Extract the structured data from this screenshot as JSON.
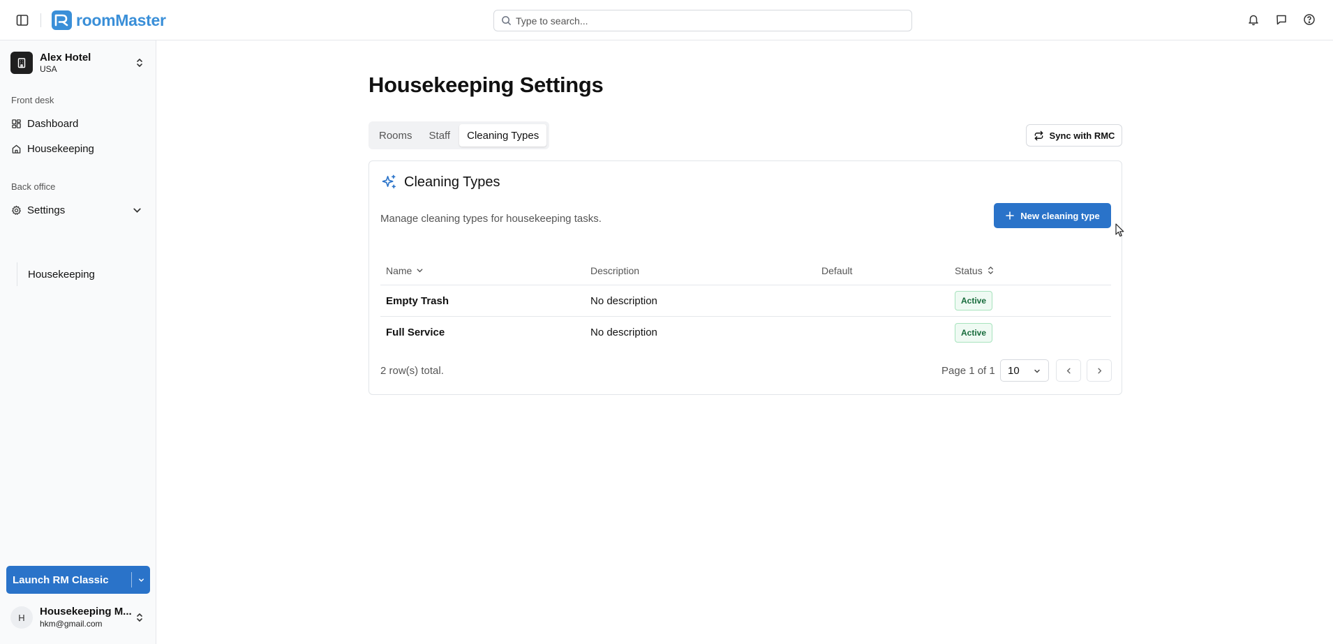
{
  "app": {
    "name": "roomMaster",
    "accent": "#2a73c9"
  },
  "search": {
    "placeholder": "Type to search..."
  },
  "topbar": {
    "icons": [
      "sidebar-toggle-icon",
      "bell-icon",
      "message-icon",
      "help-icon"
    ]
  },
  "sidebar": {
    "hotel": {
      "name": "Alex Hotel",
      "country": "USA"
    },
    "front_desk_label": "Front desk",
    "front_desk_items": [
      {
        "label": "Dashboard",
        "icon": "dashboard-icon"
      },
      {
        "label": "Housekeeping",
        "icon": "home-icon"
      }
    ],
    "back_office_label": "Back office",
    "settings": {
      "label": "Settings",
      "icon": "gear-icon",
      "expanded": true,
      "children": [
        {
          "label": "Housekeeping"
        }
      ]
    },
    "launch": {
      "label": "Launch RM Classic"
    },
    "user": {
      "initial": "H",
      "name": "Housekeeping M...",
      "email": "hkm@gmail.com"
    }
  },
  "page": {
    "title": "Housekeeping Settings",
    "tabs": [
      {
        "label": "Rooms"
      },
      {
        "label": "Staff"
      },
      {
        "label": "Cleaning Types",
        "active": true
      }
    ],
    "sync_label": "Sync with RMC"
  },
  "card": {
    "title": "Cleaning Types",
    "description": "Manage cleaning types for housekeeping tasks.",
    "new_button": "New cleaning type",
    "columns": [
      "Name",
      "Description",
      "Default",
      "Status"
    ],
    "rows": [
      {
        "name": "Empty Trash",
        "description": "No description",
        "default": "",
        "status": "Active"
      },
      {
        "name": "Full Service",
        "description": "No description",
        "default": "",
        "status": "Active"
      }
    ],
    "total_text": "2 row(s) total.",
    "page_text": "Page 1 of 1",
    "page_size": "10"
  }
}
